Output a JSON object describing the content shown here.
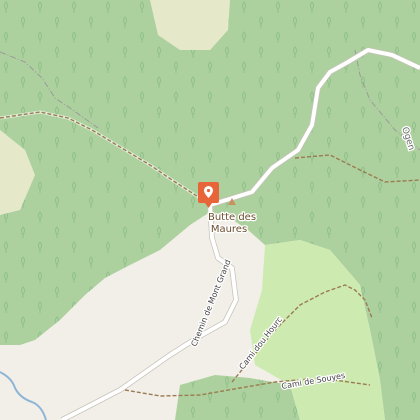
{
  "map": {
    "peak_name_line1": "Butte des",
    "peak_name_line2": "Maures",
    "roads": {
      "chemin_mont_grand": "Chemin de Mont Grand",
      "cami_dou_hourc": "Cami dou Hourc",
      "cami_de_souyes": "Cami de Souyes"
    },
    "partial_label": "Ogen",
    "colors": {
      "forest": "#add19e",
      "meadow": "#cdebb0",
      "scrub": "#e6e9c9",
      "land": "#f2efe9",
      "road": "#ffffff",
      "track": "#9b7b52",
      "water": "#8fb5d6",
      "marker": "#e8653a"
    },
    "marker_icon": "location-pin-icon",
    "peak_icon": "peak-triangle-icon"
  }
}
